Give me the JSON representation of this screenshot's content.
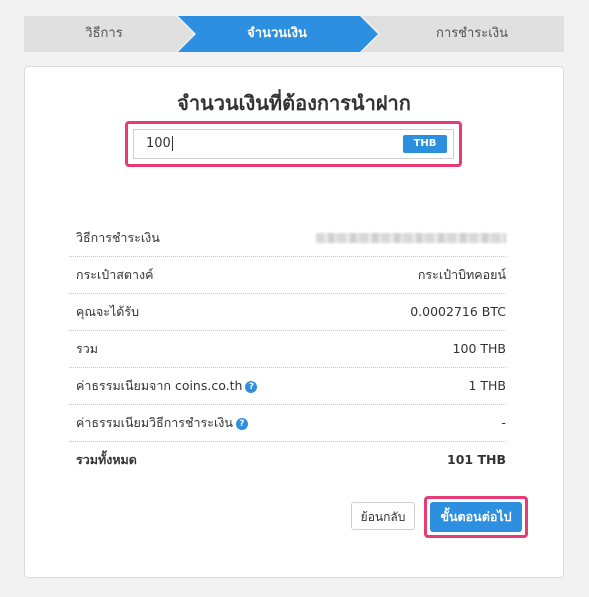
{
  "steps": [
    {
      "label": "วิธีการ"
    },
    {
      "label": "จำนวนเงิน"
    },
    {
      "label": "การชำระเงิน"
    }
  ],
  "form": {
    "title": "จำนวนเงินที่ต้องการนำฝาก",
    "amount_value": "100",
    "currency": "THB"
  },
  "summary": {
    "rows": [
      {
        "label": "วิธีการชำระเงิน",
        "value": ""
      },
      {
        "label": "กระเป๋าสตางค์",
        "value": "กระเป๋าบิทคอยน์"
      },
      {
        "label": "คุณจะได้รับ",
        "value": "0.0002716 BTC"
      },
      {
        "label": "รวม",
        "value": "100 THB"
      },
      {
        "label": "ค่าธรรมเนียมจาก coins.co.th",
        "value": "1 THB"
      },
      {
        "label": "ค่าธรรมเนียมวิธีการชำระเงิน",
        "value": "-"
      },
      {
        "label": "รวมทั้งหมด",
        "value": "101 THB"
      }
    ]
  },
  "actions": {
    "back_label": "ย้อนกลับ",
    "next_label": "ขั้นตอนต่อไป"
  },
  "colors": {
    "accent": "#2d8fe0",
    "highlight": "#e83a74",
    "step_inactive": "#e0e0e0"
  },
  "icons": {
    "help": "question-circle-icon"
  }
}
